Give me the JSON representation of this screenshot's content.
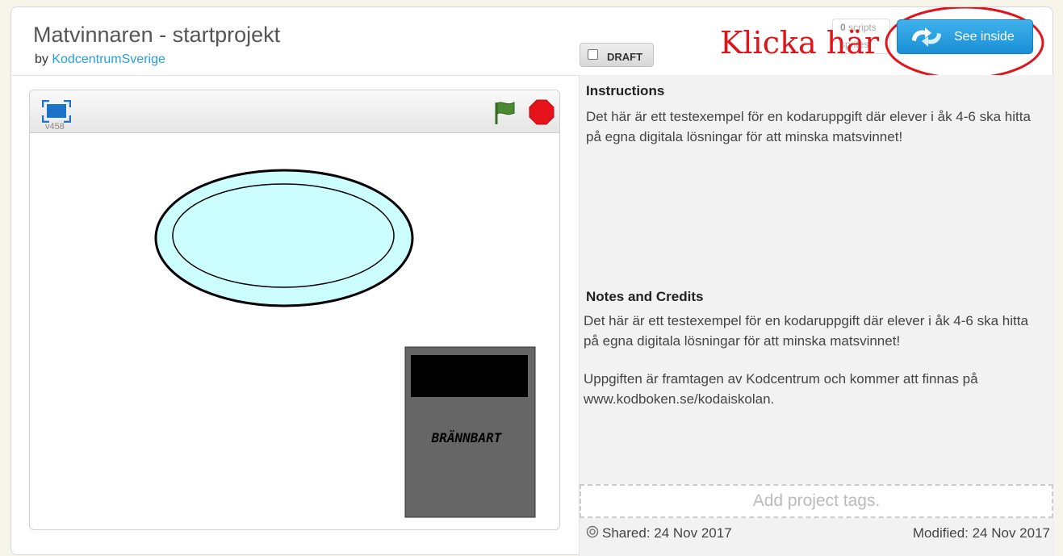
{
  "project": {
    "title": "Matvinnaren - startprojekt",
    "by_label": "by",
    "author": "KodcentrumSverige"
  },
  "draft_label": "DRAFT",
  "stats": {
    "scripts_count": "0",
    "scripts_label": "scripts",
    "sprites_label": "sprites"
  },
  "see_inside_label": "See inside",
  "annotation_text": "Klicka här",
  "player": {
    "version": "v458",
    "sprite_label": "BRÄNNBART"
  },
  "instructions": {
    "heading": "Instructions",
    "text": "Det här är ett testexempel för en kodaruppgift där elever i åk 4-6 ska hitta på egna digitala lösningar för att minska matsvinnet!"
  },
  "notes": {
    "heading": "Notes and Credits",
    "text1": "Det här är ett testexempel för en kodaruppgift där elever i åk 4-6 ska hitta på egna digitala lösningar för att minska matsvinnet!",
    "text2": "Uppgiften är framtagen av Kodcentrum och kommer att finnas på www.kodboken.se/kodaiskolan."
  },
  "tags_placeholder": "Add project tags.",
  "shared": "Shared: 24 Nov 2017",
  "modified": "Modified: 24 Nov 2017",
  "colors": {
    "accent": "#25a0db",
    "annotation": "#e0141a",
    "bowl_fill": "#ccfeff",
    "bin": "#666666"
  },
  "icons": [
    "fullscreen-icon",
    "green-flag-icon",
    "stop-icon",
    "see-inside-arrows-icon",
    "shared-icon"
  ]
}
